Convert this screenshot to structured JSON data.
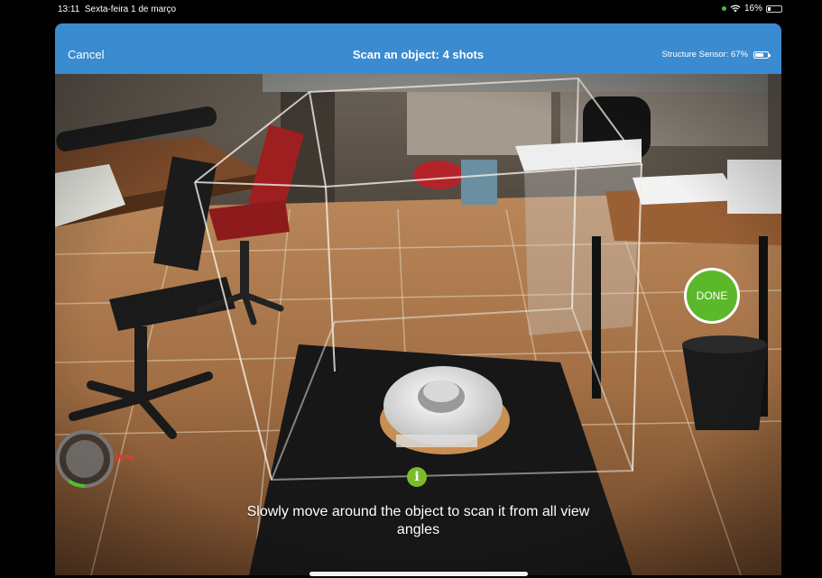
{
  "status_bar": {
    "time": "13:11",
    "date": "Sexta-feira 1 de março",
    "battery_percent": "16%"
  },
  "navbar": {
    "cancel_label": "Cancel",
    "title": "Scan an object: 4 shots",
    "sensor_status": "Structure Sensor: 67%",
    "sensor_battery_level": 0.67
  },
  "scan": {
    "done_label": "DONE",
    "progress_label": "10%",
    "progress_value": 0.1,
    "info_glyph": "i",
    "instruction": "Slowly move around the object to scan it from all view angles"
  },
  "colors": {
    "navbar": "#3a8bd0",
    "done_button": "#5bb82a",
    "info_icon": "#7dbb2e",
    "progress_text": "#e83b2f"
  }
}
